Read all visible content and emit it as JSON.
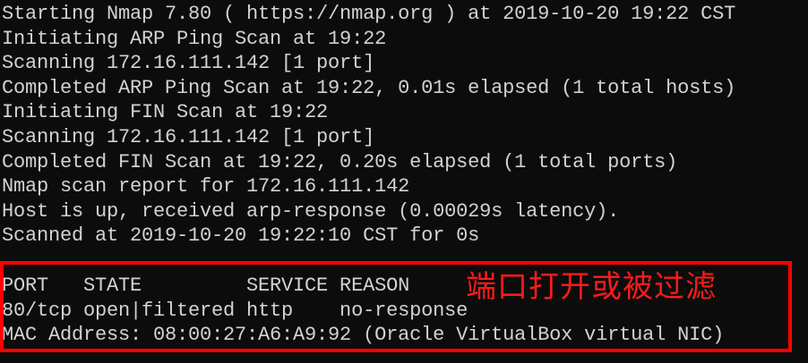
{
  "terminal": {
    "lines": [
      "Starting Nmap 7.80 ( https://nmap.org ) at 2019-10-20 19:22 CST",
      "Initiating ARP Ping Scan at 19:22",
      "Scanning 172.16.111.142 [1 port]",
      "Completed ARP Ping Scan at 19:22, 0.01s elapsed (1 total hosts)",
      "Initiating FIN Scan at 19:22",
      "Scanning 172.16.111.142 [1 port]",
      "Completed FIN Scan at 19:22, 0.20s elapsed (1 total ports)",
      "Nmap scan report for 172.16.111.142",
      "Host is up, received arp-response (0.00029s latency).",
      "Scanned at 2019-10-20 19:22:10 CST for 0s"
    ],
    "port_table": {
      "header": "PORT   STATE         SERVICE REASON",
      "row": "80/tcp open|filtered http    no-response",
      "mac": "MAC Address: 08:00:27:A6:A9:92 (Oracle VirtualBox virtual NIC)"
    }
  },
  "annotation": {
    "text": "端口打开或被过滤",
    "color": "#ff1a1a"
  },
  "colors": {
    "background": "#0c0c0c",
    "text": "#d2d2d2",
    "highlight_border": "#ff0000"
  }
}
